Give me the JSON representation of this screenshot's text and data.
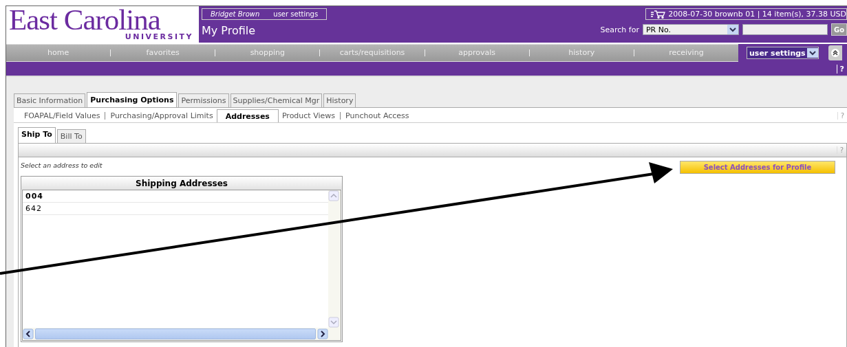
{
  "logo": {
    "name": "East Carolina",
    "subtitle": "UNIVERSITY"
  },
  "user": {
    "name": "Bridget Brown",
    "link": "user settings"
  },
  "page_title": "My Profile",
  "cart": {
    "summary": "2008-07-30 brownb 01 | 14 item(s), 37.38 USD"
  },
  "search": {
    "label": "Search for",
    "type": "PR No.",
    "button": "Go"
  },
  "nav": {
    "items": [
      "home",
      "favorites",
      "shopping",
      "carts/requisitions",
      "approvals",
      "history",
      "receiving"
    ],
    "menu": "user settings"
  },
  "bar_help": "?",
  "tabs": [
    {
      "label": "Basic Information",
      "selected": false
    },
    {
      "label": "Purchasing Options",
      "selected": true
    },
    {
      "label": "Permissions",
      "selected": false
    },
    {
      "label": "Supplies/Chemical Mgr",
      "selected": false
    },
    {
      "label": "History",
      "selected": false
    }
  ],
  "subtabs": [
    {
      "label": "FOAPAL/Field Values",
      "selected": false
    },
    {
      "label": "Purchasing/Approval Limits",
      "selected": false
    },
    {
      "label": "Addresses",
      "selected": true
    },
    {
      "label": "Product Views",
      "selected": false
    },
    {
      "label": "Punchout Access",
      "selected": false
    }
  ],
  "subtabs_help": "?",
  "address_tabs": [
    {
      "label": "Ship To",
      "selected": true
    },
    {
      "label": "Bill To",
      "selected": false
    }
  ],
  "panel_help": "?",
  "hint": "Select an address to edit",
  "action_button": "Select Addresses for Profile",
  "list": {
    "title": "Shipping Addresses",
    "rows": [
      {
        "value": "004",
        "selected": true
      },
      {
        "value": "642",
        "selected": false
      }
    ]
  }
}
